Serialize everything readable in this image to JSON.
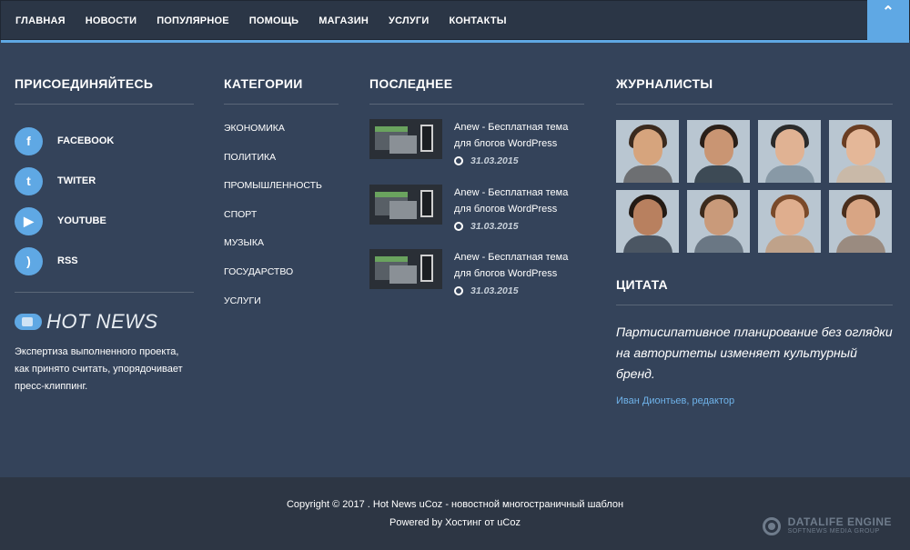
{
  "nav": {
    "items": [
      "ГЛАВНАЯ",
      "НОВОСТИ",
      "ПОПУЛЯРНОЕ",
      "ПОМОЩЬ",
      "МАГАЗИН",
      "УСЛУГИ",
      "КОНТАКТЫ"
    ],
    "scroll_top_icon": "chevron-up-icon"
  },
  "join": {
    "title": "ПРИСОЕДИНЯЙТЕСЬ",
    "social": [
      {
        "label": "FACEBOOK",
        "icon": "facebook-icon",
        "glyph": "f"
      },
      {
        "label": "TWITER",
        "icon": "twitter-icon",
        "glyph": "t"
      },
      {
        "label": "YOUTUBE",
        "icon": "youtube-icon",
        "glyph": "▶"
      },
      {
        "label": "RSS",
        "icon": "rss-icon",
        "glyph": ")"
      }
    ],
    "logo_text": "HOT NEWS",
    "about": "Экспертиза выполненного проекта, как принято считать, упорядочивает пресс-клиппинг."
  },
  "categories": {
    "title": "КАТЕГОРИИ",
    "items": [
      "ЭКОНОМИКА",
      "ПОЛИТИКА",
      "ПРОМЫШЛЕННОСТЬ",
      "СПОРТ",
      "МУЗЫКА",
      "ГОСУДАРСТВО",
      "УСЛУГИ"
    ]
  },
  "latest": {
    "title": "ПОСЛЕДНЕЕ",
    "posts": [
      {
        "title": "Anew - Бесплатная тема для блогов WordPress",
        "date": "31.03.2015"
      },
      {
        "title": "Anew - Бесплатная тема для блогов WordPress",
        "date": "31.03.2015"
      },
      {
        "title": "Anew - Бесплатная тема для блогов WordPress",
        "date": "31.03.2015"
      }
    ]
  },
  "journalists": {
    "title": "ЖУРНАЛИСТЫ",
    "faces": [
      {
        "hair": "#3b2a1e",
        "skin": "#d6a47d",
        "shirt": "#6d6f72"
      },
      {
        "hair": "#2a1f18",
        "skin": "#c99573",
        "shirt": "#3d4a55"
      },
      {
        "hair": "#2b2b2b",
        "skin": "#e0b293",
        "shirt": "#8899a6"
      },
      {
        "hair": "#6a3d22",
        "skin": "#e4b798",
        "shirt": "#c9b9a8"
      },
      {
        "hair": "#231a14",
        "skin": "#b8805f",
        "shirt": "#4b5663"
      },
      {
        "hair": "#3c2a1c",
        "skin": "#c99a7a",
        "shirt": "#6a7784"
      },
      {
        "hair": "#7a4a2a",
        "skin": "#dfae8e",
        "shirt": "#bfa28a"
      },
      {
        "hair": "#4a2e1c",
        "skin": "#d8a584",
        "shirt": "#9a8b80"
      }
    ]
  },
  "quote": {
    "title": "ЦИТАТА",
    "text": "Партисипативное планирование без оглядки на авторитеты изменяет культурный бренд.",
    "author": "Иван Дионтьев, редактор"
  },
  "footer": {
    "copyright": "Copyright © 2017 . Hot News uCoz - новостной многостраничный шаблон",
    "powered": "Powered by Хостинг от uCoz",
    "dle_title": "DATALIFE ENGINE",
    "dle_sub": "SOFTNEWS MEDIA GROUP"
  },
  "colors": {
    "accent": "#5fa8e4",
    "background": "#34435a",
    "footer": "#2d3644"
  }
}
